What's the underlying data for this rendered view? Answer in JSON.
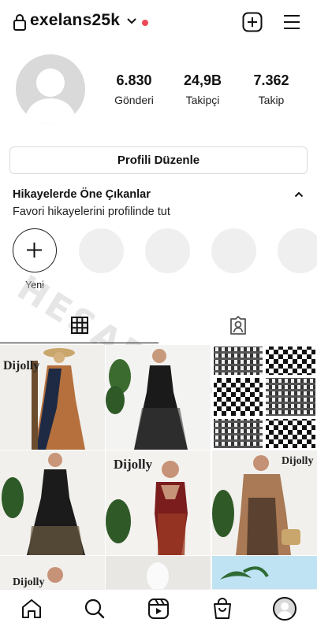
{
  "header": {
    "username": "exelans25k",
    "icons": [
      "lock-icon",
      "chevron-down-icon",
      "notification-dot",
      "add-post-icon",
      "menu-icon"
    ],
    "dot_color": "#ed4956"
  },
  "profile": {
    "stats": [
      {
        "value": "6.830",
        "label": "Gönderi"
      },
      {
        "value": "24,9B",
        "label": "Takipçi"
      },
      {
        "value": "7.362",
        "label": "Takip"
      }
    ],
    "edit_profile_label": "Profili Düzenle"
  },
  "highlights": {
    "title": "Hikayelerde Öne Çıkanlar",
    "subtitle": "Favori hikayelerini profilinde tut",
    "new_label": "Yeni"
  },
  "tabs": [
    {
      "icon": "grid-icon",
      "active": true
    },
    {
      "icon": "tagged-icon",
      "active": false
    }
  ],
  "posts": {
    "brand_text": "Dijolly",
    "items": [
      "dress-photo",
      "dress-photo",
      "checkered-fabric",
      "dress-photo",
      "dress-photo",
      "dress-photo",
      "dress-photo",
      "dress-photo",
      "palm-photo"
    ]
  },
  "watermark": "HESAPSATIN",
  "nav": {
    "icons": [
      "home-icon",
      "search-icon",
      "reels-icon",
      "shop-icon",
      "profile-avatar"
    ]
  }
}
